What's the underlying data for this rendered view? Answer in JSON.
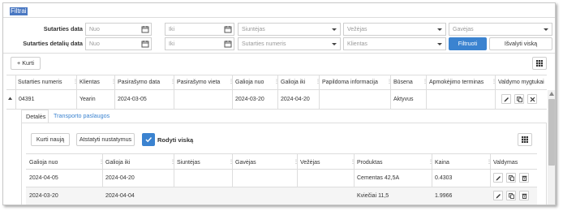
{
  "filter_title": "Filtrai",
  "filters": {
    "row1_label": "Sutarties data",
    "row2_label": "Sutarties detalių data",
    "from_placeholder": "Nuo",
    "to_placeholder": "Iki",
    "shipper_placeholder": "Siuntėjas",
    "carrier_placeholder": "Vežėjas",
    "receiver_placeholder": "Gavėjas",
    "contract_no_placeholder": "Sutarties numeris",
    "client_placeholder": "Klientas",
    "filter_button": "Filtruoti",
    "clear_button": "Išvalyti viską"
  },
  "toolbar": {
    "add_label": "+ Kurti"
  },
  "main_table": {
    "headers": [
      "Sutarties numeris",
      "Klientas",
      "Pasirašymo data",
      "Pasirašymo vieta",
      "Galioja nuo",
      "Galioja iki",
      "Papildoma informacija",
      "Būsena",
      "Apmokėjimo terminas",
      "Valdymo mygtukai"
    ],
    "row": {
      "number": "04391",
      "client": "Yearin",
      "signed": "2024-03-05",
      "place": "",
      "from": "2024-03-20",
      "to": "2024-04-20",
      "info": "",
      "status": "Aktyvus",
      "term": ""
    }
  },
  "detail": {
    "tabs": [
      "Detalės",
      "Transporto paslaugos"
    ],
    "create_button": "Kurti naują",
    "reset_button": "Atstatyti nustatymus",
    "show_all_label": "Rodyti viską",
    "headers": [
      "Galioja nuo",
      "Galioja iki",
      "Siuntėjas",
      "Gavėjas",
      "Vežėjas",
      "Produktas",
      "Kaina",
      "Valdymas"
    ],
    "rows": [
      {
        "from": "2024-04-05",
        "to": "2024-04-20",
        "shipper": "",
        "receiver": "",
        "carrier": "",
        "product": "Cementas 42,5A",
        "price": "0.4303"
      },
      {
        "from": "2024-03-20",
        "to": "2024-04-04",
        "shipper": "",
        "receiver": "",
        "carrier": "",
        "product": "Kviečiai 11,5",
        "price": "1.9966"
      }
    ]
  },
  "colors": {
    "accent": "#3b83d0",
    "title_highlight": "#4a78c2"
  }
}
